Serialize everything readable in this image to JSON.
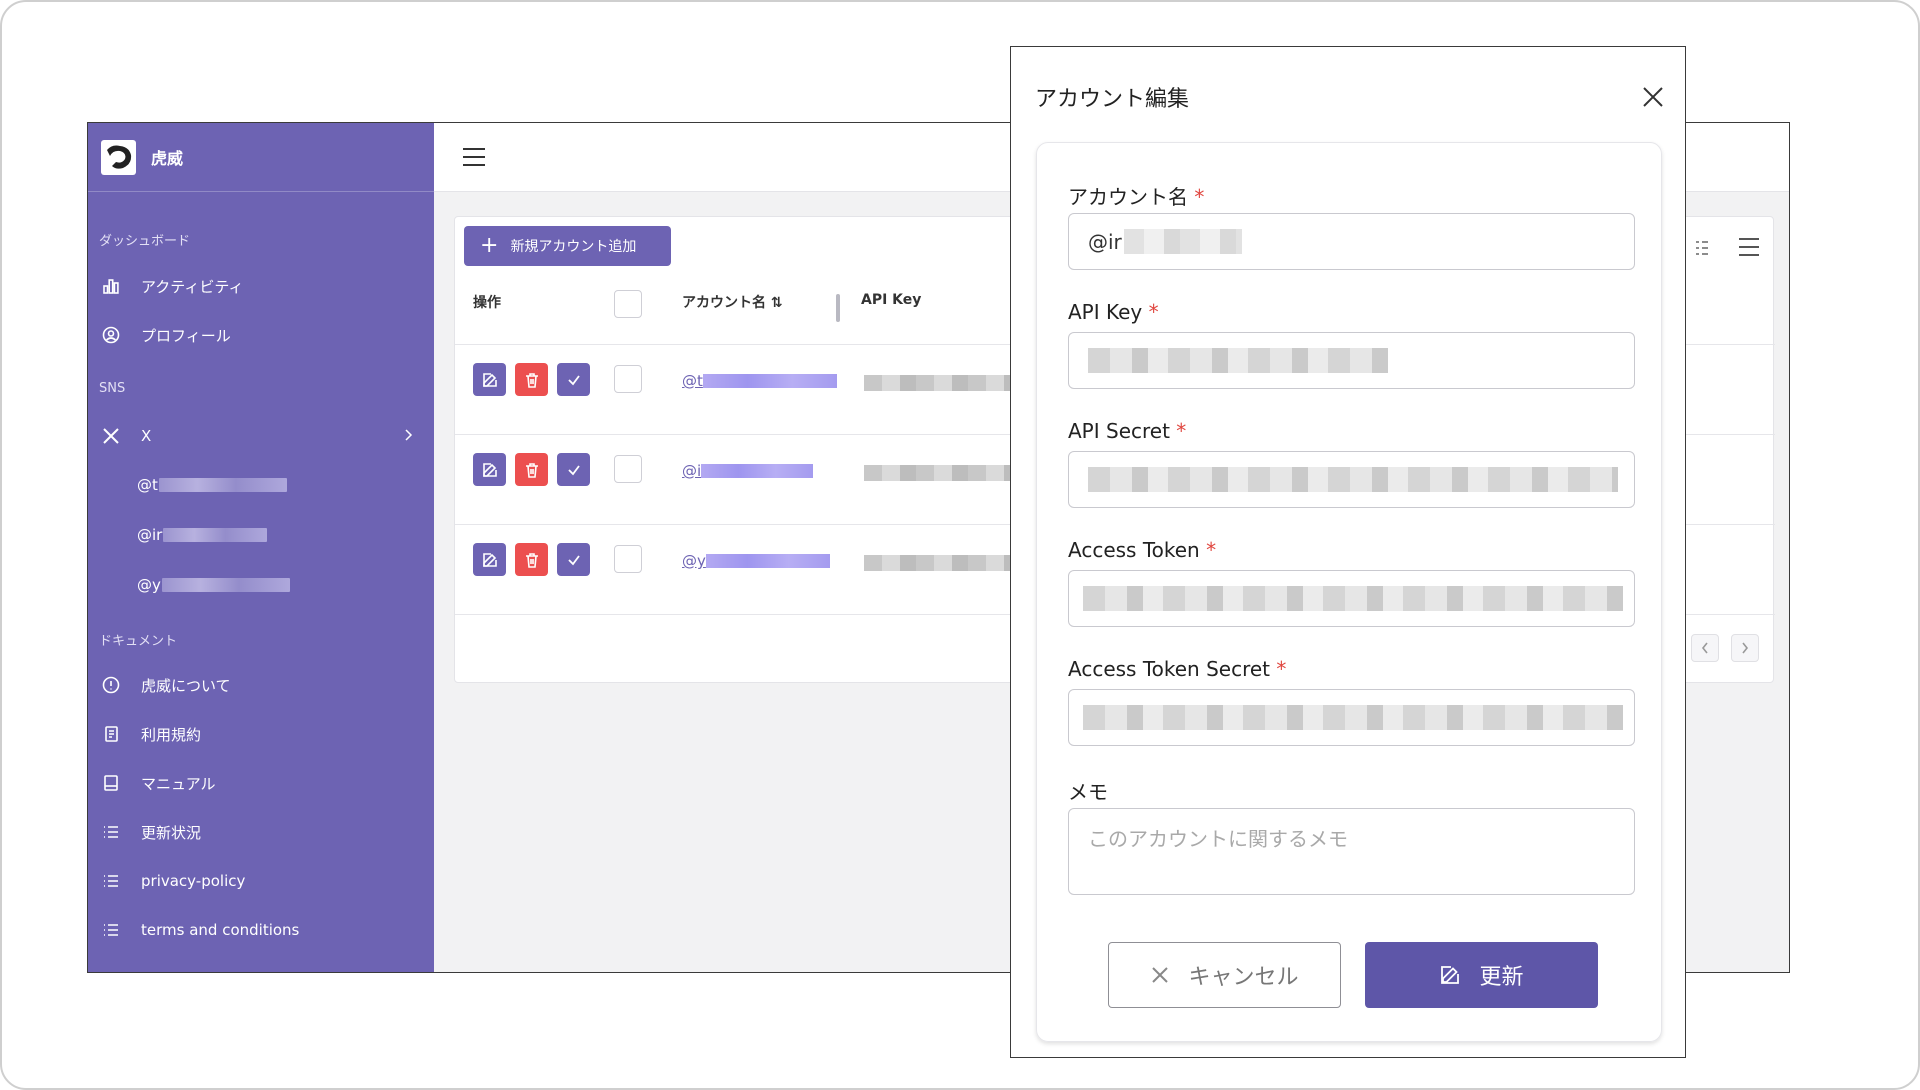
{
  "app": {
    "brand": "虎威"
  },
  "sidebar": {
    "sections": {
      "dashboard": "ダッシュボード",
      "sns": "SNS",
      "docs": "ドキュメント"
    },
    "items": {
      "activity": "アクティビティ",
      "profile": "プロフィール",
      "x": "X",
      "about": "虎威について",
      "terms_ja": "利用規約",
      "manual": "マニュアル",
      "updates": "更新状況",
      "privacy": "privacy-policy",
      "terms_en": "terms and conditions"
    },
    "x_accounts": [
      "@t",
      "@ir",
      "@y"
    ]
  },
  "table": {
    "add_button": "新規アカウント追加",
    "headers": {
      "ops": "操作",
      "account": "アカウント名 ⇅",
      "api_key": "API Key"
    },
    "rows": [
      {
        "account": "@t"
      },
      {
        "account": "@i"
      },
      {
        "account": "@y"
      }
    ]
  },
  "modal": {
    "title": "アカウント編集",
    "required_mark": "*",
    "fields": {
      "account_name": {
        "label": "アカウント名",
        "value": "@ir"
      },
      "api_key": {
        "label": "API Key"
      },
      "api_secret": {
        "label": "API Secret"
      },
      "access_token": {
        "label": "Access Token"
      },
      "access_token_secret": {
        "label": "Access Token Secret"
      },
      "memo": {
        "label": "メモ",
        "placeholder": "このアカウントに関するメモ"
      }
    },
    "cancel": "キャンセル",
    "update": "更新"
  },
  "colors": {
    "accent": "#6d63b3",
    "danger": "#ec4f4f",
    "required": "#e0463f"
  }
}
